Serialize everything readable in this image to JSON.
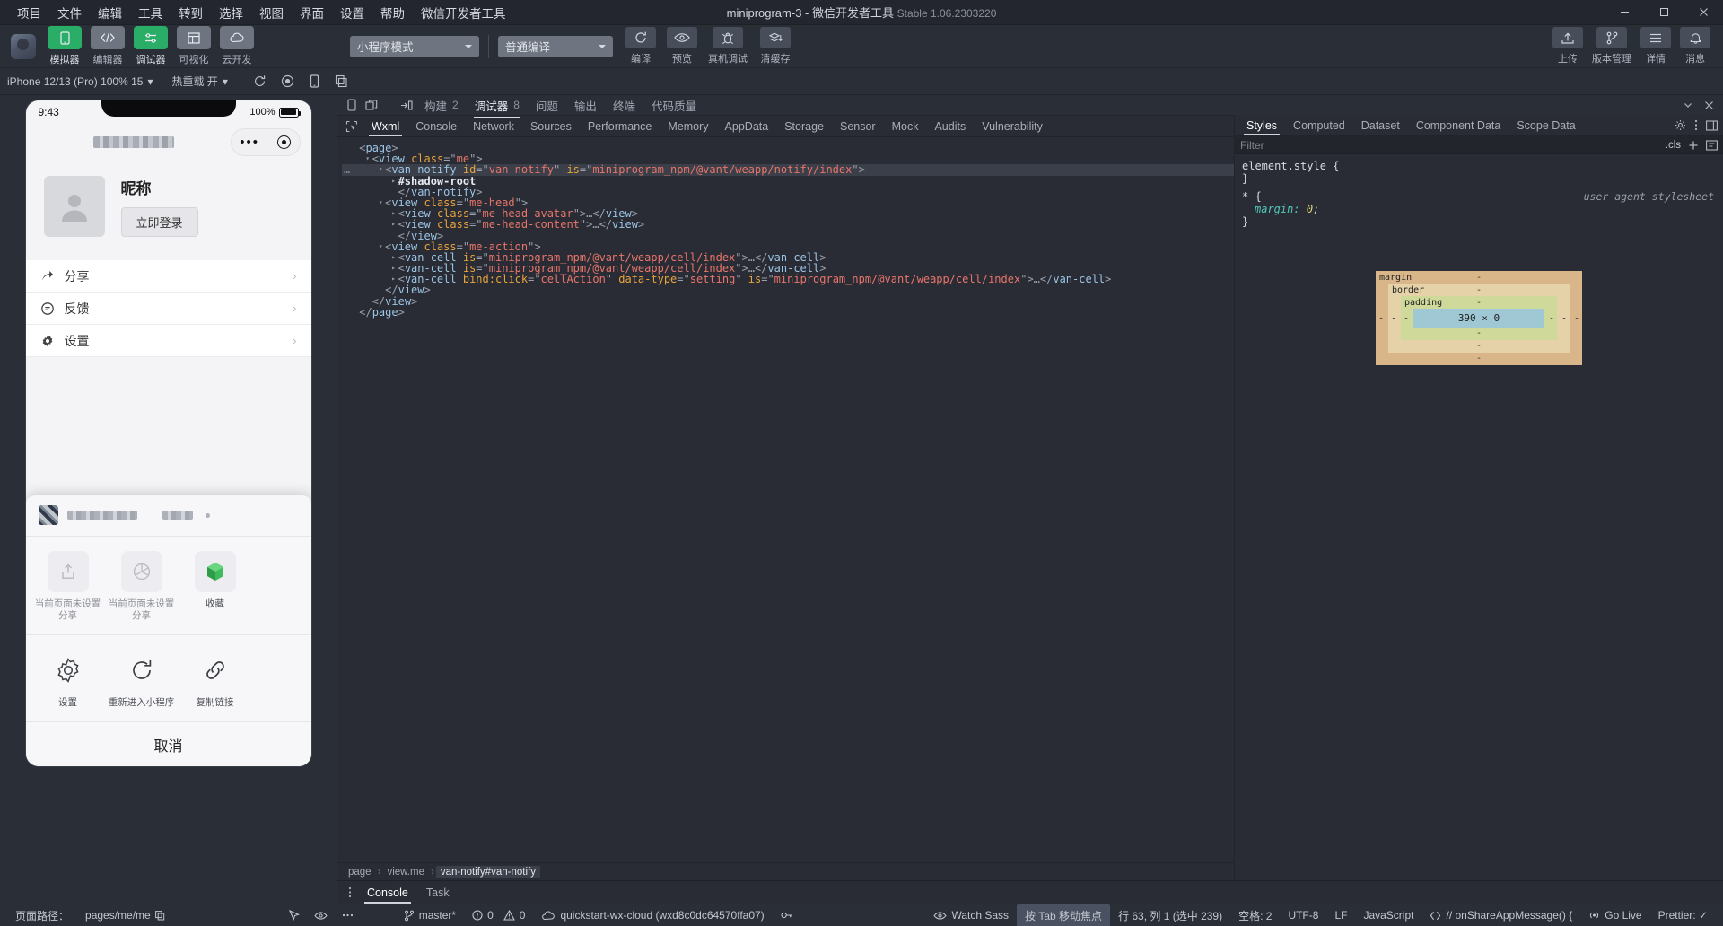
{
  "titlebar": {
    "menus": [
      "项目",
      "文件",
      "编辑",
      "工具",
      "转到",
      "选择",
      "视图",
      "界面",
      "设置",
      "帮助",
      "微信开发者工具"
    ],
    "title": "miniprogram-3 - 微信开发者工具",
    "version": "Stable 1.06.2303220",
    "window_controls": {
      "minimize": "—",
      "maximize": "❐",
      "close": "✕"
    }
  },
  "toolbar": {
    "modes": [
      {
        "label": "模拟器",
        "icon": "phone-icon",
        "active": true
      },
      {
        "label": "编辑器",
        "icon": "code-icon",
        "active": false
      },
      {
        "label": "调试器",
        "icon": "debugger-icon",
        "active": true
      },
      {
        "label": "可视化",
        "icon": "layout-icon",
        "active": false
      },
      {
        "label": "云开发",
        "icon": "cloud-icon",
        "active": false
      }
    ],
    "mode_select": {
      "value": "小程序模式",
      "icon": "chevron-down-icon"
    },
    "compile_select": {
      "value": "普通编译",
      "icon": "chevron-down-icon"
    },
    "actions": [
      {
        "label": "编译",
        "icon": "refresh-icon"
      },
      {
        "label": "预览",
        "icon": "eye-icon"
      },
      {
        "label": "真机调试",
        "icon": "bug-icon"
      },
      {
        "label": "清缓存",
        "icon": "layers-icon"
      }
    ],
    "right_actions": [
      {
        "label": "上传",
        "icon": "upload-icon"
      },
      {
        "label": "版本管理",
        "icon": "branch-icon"
      },
      {
        "label": "详情",
        "icon": "list-icon"
      },
      {
        "label": "消息",
        "icon": "bell-icon"
      }
    ]
  },
  "strip": {
    "device": "iPhone 12/13 (Pro) 100% 15",
    "device_caret": "▾",
    "hot_reload": "热重载 开",
    "hot_caret": "▾",
    "icons": [
      "rotate-icon",
      "record-icon",
      "device-icon",
      "copy-icon"
    ]
  },
  "simulator": {
    "status_time": "9:43",
    "battery_pct": "100%",
    "nav_dots": "•••",
    "me": {
      "nickname": "昵称",
      "login_button": "立即登录",
      "cells": [
        {
          "label": "分享",
          "icon": "share-icon",
          "arrow": "›"
        },
        {
          "label": "反馈",
          "icon": "feedback-icon",
          "arrow": "›"
        },
        {
          "label": "设置",
          "icon": "gear-icon",
          "arrow": "›"
        }
      ]
    },
    "sheet": {
      "row1": [
        {
          "label": "当前页面未设置分享",
          "icon": "share-out-icon",
          "disabled": true
        },
        {
          "label": "当前页面未设置分享",
          "icon": "moments-icon",
          "disabled": true
        },
        {
          "label": "收藏",
          "icon": "favorite-icon",
          "disabled": false
        }
      ],
      "row2": [
        {
          "label": "设置",
          "icon": "gear-icon"
        },
        {
          "label": "重新进入小程序",
          "icon": "reload-icon"
        },
        {
          "label": "复制链接",
          "icon": "link-icon"
        }
      ],
      "cancel": "取消"
    }
  },
  "devtools": {
    "panel_tabs": [
      {
        "label": "构建",
        "count": "2",
        "active": false
      },
      {
        "label": "调试器",
        "count": "8",
        "active": true
      },
      {
        "label": "问题",
        "count": "",
        "active": false
      },
      {
        "label": "输出",
        "count": "",
        "active": false
      },
      {
        "label": "终端",
        "count": "",
        "active": false
      },
      {
        "label": "代码质量",
        "count": "",
        "active": false
      }
    ],
    "panel_tab_icons": [
      "phone-toggle-icon",
      "detach-icon",
      "dock-icon"
    ],
    "panel_right_icons": [
      "chevron-down-icon",
      "close-icon"
    ],
    "element_tabs": [
      "Wxml",
      "Console",
      "Network",
      "Sources",
      "Performance",
      "Memory",
      "AppData",
      "Storage",
      "Sensor",
      "Mock",
      "Audits",
      "Vulnerability"
    ],
    "element_active_tab": "Wxml",
    "element_inspect_icon": "cursor-select-icon",
    "warning_count": "8",
    "element_right_icons": [
      "gear-icon",
      "kebab-icon",
      "dock-right-icon"
    ],
    "tree": [
      {
        "indent": 0,
        "twisty": "",
        "selected": false,
        "parts": [
          {
            "t": "punc",
            "v": "<"
          },
          {
            "t": "tag",
            "v": "page"
          },
          {
            "t": "punc",
            "v": ">"
          }
        ]
      },
      {
        "indent": 1,
        "twisty": "▾",
        "selected": false,
        "parts": [
          {
            "t": "punc",
            "v": "<"
          },
          {
            "t": "tag",
            "v": "view"
          },
          {
            "t": "punc",
            "v": " "
          },
          {
            "t": "attr",
            "v": "class"
          },
          {
            "t": "punc",
            "v": "=\""
          },
          {
            "t": "val",
            "v": "me"
          },
          {
            "t": "punc",
            "v": "\">"
          }
        ]
      },
      {
        "indent": 2,
        "twisty": "▾",
        "selected": true,
        "dots": "…",
        "parts": [
          {
            "t": "punc",
            "v": "<"
          },
          {
            "t": "tag",
            "v": "van-notify"
          },
          {
            "t": "punc",
            "v": " "
          },
          {
            "t": "attr",
            "v": "id"
          },
          {
            "t": "punc",
            "v": "=\""
          },
          {
            "t": "val",
            "v": "van-notify"
          },
          {
            "t": "punc",
            "v": "\" "
          },
          {
            "t": "attr",
            "v": "is"
          },
          {
            "t": "punc",
            "v": "=\""
          },
          {
            "t": "val",
            "v": "miniprogram_npm/@vant/weapp/notify/index"
          },
          {
            "t": "punc",
            "v": "\">"
          }
        ]
      },
      {
        "indent": 3,
        "twisty": "▸",
        "selected": false,
        "parts": [
          {
            "t": "sh",
            "v": "#shadow-root"
          }
        ]
      },
      {
        "indent": 3,
        "twisty": "",
        "selected": false,
        "parts": [
          {
            "t": "punc",
            "v": "</"
          },
          {
            "t": "tag",
            "v": "van-notify"
          },
          {
            "t": "punc",
            "v": ">"
          }
        ]
      },
      {
        "indent": 2,
        "twisty": "▾",
        "selected": false,
        "parts": [
          {
            "t": "punc",
            "v": "<"
          },
          {
            "t": "tag",
            "v": "view"
          },
          {
            "t": "punc",
            "v": " "
          },
          {
            "t": "attr",
            "v": "class"
          },
          {
            "t": "punc",
            "v": "=\""
          },
          {
            "t": "val",
            "v": "me-head"
          },
          {
            "t": "punc",
            "v": "\">"
          }
        ]
      },
      {
        "indent": 3,
        "twisty": "▸",
        "selected": false,
        "parts": [
          {
            "t": "punc",
            "v": "<"
          },
          {
            "t": "tag",
            "v": "view"
          },
          {
            "t": "punc",
            "v": " "
          },
          {
            "t": "attr",
            "v": "class"
          },
          {
            "t": "punc",
            "v": "=\""
          },
          {
            "t": "val",
            "v": "me-head-avatar"
          },
          {
            "t": "punc",
            "v": "\">…</"
          },
          {
            "t": "tag",
            "v": "view"
          },
          {
            "t": "punc",
            "v": ">"
          }
        ]
      },
      {
        "indent": 3,
        "twisty": "▸",
        "selected": false,
        "parts": [
          {
            "t": "punc",
            "v": "<"
          },
          {
            "t": "tag",
            "v": "view"
          },
          {
            "t": "punc",
            "v": " "
          },
          {
            "t": "attr",
            "v": "class"
          },
          {
            "t": "punc",
            "v": "=\""
          },
          {
            "t": "val",
            "v": "me-head-content"
          },
          {
            "t": "punc",
            "v": "\">…</"
          },
          {
            "t": "tag",
            "v": "view"
          },
          {
            "t": "punc",
            "v": ">"
          }
        ]
      },
      {
        "indent": 3,
        "twisty": "",
        "selected": false,
        "parts": [
          {
            "t": "punc",
            "v": "</"
          },
          {
            "t": "tag",
            "v": "view"
          },
          {
            "t": "punc",
            "v": ">"
          }
        ]
      },
      {
        "indent": 2,
        "twisty": "▾",
        "selected": false,
        "parts": [
          {
            "t": "punc",
            "v": "<"
          },
          {
            "t": "tag",
            "v": "view"
          },
          {
            "t": "punc",
            "v": " "
          },
          {
            "t": "attr",
            "v": "class"
          },
          {
            "t": "punc",
            "v": "=\""
          },
          {
            "t": "val",
            "v": "me-action"
          },
          {
            "t": "punc",
            "v": "\">"
          }
        ]
      },
      {
        "indent": 3,
        "twisty": "▸",
        "selected": false,
        "parts": [
          {
            "t": "punc",
            "v": "<"
          },
          {
            "t": "tag",
            "v": "van-cell"
          },
          {
            "t": "punc",
            "v": " "
          },
          {
            "t": "attr",
            "v": "is"
          },
          {
            "t": "punc",
            "v": "=\""
          },
          {
            "t": "val",
            "v": "miniprogram_npm/@vant/weapp/cell/index"
          },
          {
            "t": "punc",
            "v": "\">…</"
          },
          {
            "t": "tag",
            "v": "van-cell"
          },
          {
            "t": "punc",
            "v": ">"
          }
        ]
      },
      {
        "indent": 3,
        "twisty": "▸",
        "selected": false,
        "parts": [
          {
            "t": "punc",
            "v": "<"
          },
          {
            "t": "tag",
            "v": "van-cell"
          },
          {
            "t": "punc",
            "v": " "
          },
          {
            "t": "attr",
            "v": "is"
          },
          {
            "t": "punc",
            "v": "=\""
          },
          {
            "t": "val",
            "v": "miniprogram_npm/@vant/weapp/cell/index"
          },
          {
            "t": "punc",
            "v": "\">…</"
          },
          {
            "t": "tag",
            "v": "van-cell"
          },
          {
            "t": "punc",
            "v": ">"
          }
        ]
      },
      {
        "indent": 3,
        "twisty": "▸",
        "selected": false,
        "parts": [
          {
            "t": "punc",
            "v": "<"
          },
          {
            "t": "tag",
            "v": "van-cell"
          },
          {
            "t": "punc",
            "v": " "
          },
          {
            "t": "attr",
            "v": "bind:click"
          },
          {
            "t": "punc",
            "v": "=\""
          },
          {
            "t": "val",
            "v": "cellAction"
          },
          {
            "t": "punc",
            "v": "\" "
          },
          {
            "t": "attr",
            "v": "data-type"
          },
          {
            "t": "punc",
            "v": "=\""
          },
          {
            "t": "val",
            "v": "setting"
          },
          {
            "t": "punc",
            "v": "\" "
          },
          {
            "t": "attr",
            "v": "is"
          },
          {
            "t": "punc",
            "v": "=\""
          },
          {
            "t": "val",
            "v": "miniprogram_npm/@vant/weapp/cell/index"
          },
          {
            "t": "punc",
            "v": "\">…</"
          },
          {
            "t": "tag",
            "v": "van-cell"
          },
          {
            "t": "punc",
            "v": ">"
          }
        ]
      },
      {
        "indent": 2,
        "twisty": "",
        "selected": false,
        "parts": [
          {
            "t": "punc",
            "v": "</"
          },
          {
            "t": "tag",
            "v": "view"
          },
          {
            "t": "punc",
            "v": ">"
          }
        ]
      },
      {
        "indent": 1,
        "twisty": "",
        "selected": false,
        "parts": [
          {
            "t": "punc",
            "v": "</"
          },
          {
            "t": "tag",
            "v": "view"
          },
          {
            "t": "punc",
            "v": ">"
          }
        ]
      },
      {
        "indent": 0,
        "twisty": "",
        "selected": false,
        "parts": [
          {
            "t": "punc",
            "v": "</"
          },
          {
            "t": "tag",
            "v": "page"
          },
          {
            "t": "punc",
            "v": ">"
          }
        ]
      }
    ],
    "breadcrumb": [
      {
        "label": "page",
        "active": false
      },
      {
        "label": "view.me",
        "active": false
      },
      {
        "label": "van-notify#van-notify",
        "active": true
      }
    ],
    "drawer_tabs": [
      {
        "label": "Console",
        "active": true
      },
      {
        "label": "Task",
        "active": false
      }
    ]
  },
  "styles": {
    "tabs": [
      "Styles",
      "Computed",
      "Dataset",
      "Component Data",
      "Scope Data"
    ],
    "active_tab": "Styles",
    "filter_placeholder": "Filter",
    "cls_label": ".cls",
    "add_icon": "plus-icon",
    "newstyle_icon": "new-style-rule-icon",
    "rules": [
      {
        "selector": "element.style {",
        "source": "",
        "decls": [],
        "close": "}"
      },
      {
        "selector": "* {",
        "source": "user agent stylesheet",
        "decls": [
          {
            "prop": "margin",
            "value": "0;"
          }
        ],
        "close": "}"
      }
    ],
    "boxmodel": {
      "margin_label": "margin",
      "border_label": "border",
      "padding_label": "padding",
      "content": "390 × 0",
      "dash": "-"
    }
  },
  "statusbar": {
    "left": [
      {
        "label": "页面路径：",
        "icon": ""
      },
      {
        "label": "pages/me/me",
        "icon": "copy-icon"
      }
    ],
    "left_icons": [
      "cursor-icon",
      "eye-icon",
      "kebab-icon"
    ],
    "git_branch": "master*",
    "git_icon": "branch-icon",
    "problems": {
      "errors": "0",
      "warnings": "0",
      "error_icon": "error-icon",
      "warning_icon": "warning-icon"
    },
    "cloud_env": "quickstart-wx-cloud (wxd8c0dc64570ffa07)",
    "cloud_icon": "cloud-icon",
    "key_icon": "key-icon",
    "right": [
      {
        "label": "Watch Sass",
        "icon": "eye-icon"
      },
      {
        "label": "按 Tab 移动焦点",
        "icon": "",
        "highlight": true
      },
      {
        "label": "行 63, 列 1 (选中 239)",
        "icon": ""
      },
      {
        "label": "空格: 2",
        "icon": ""
      },
      {
        "label": "UTF-8",
        "icon": ""
      },
      {
        "label": "LF",
        "icon": ""
      },
      {
        "label": "JavaScript",
        "icon": ""
      },
      {
        "label": "// onShareAppMessage() {",
        "icon": "code-brackets-icon"
      },
      {
        "label": "Go Live",
        "icon": "broadcast-icon"
      },
      {
        "label": "Prettier: ✓",
        "icon": ""
      }
    ]
  }
}
